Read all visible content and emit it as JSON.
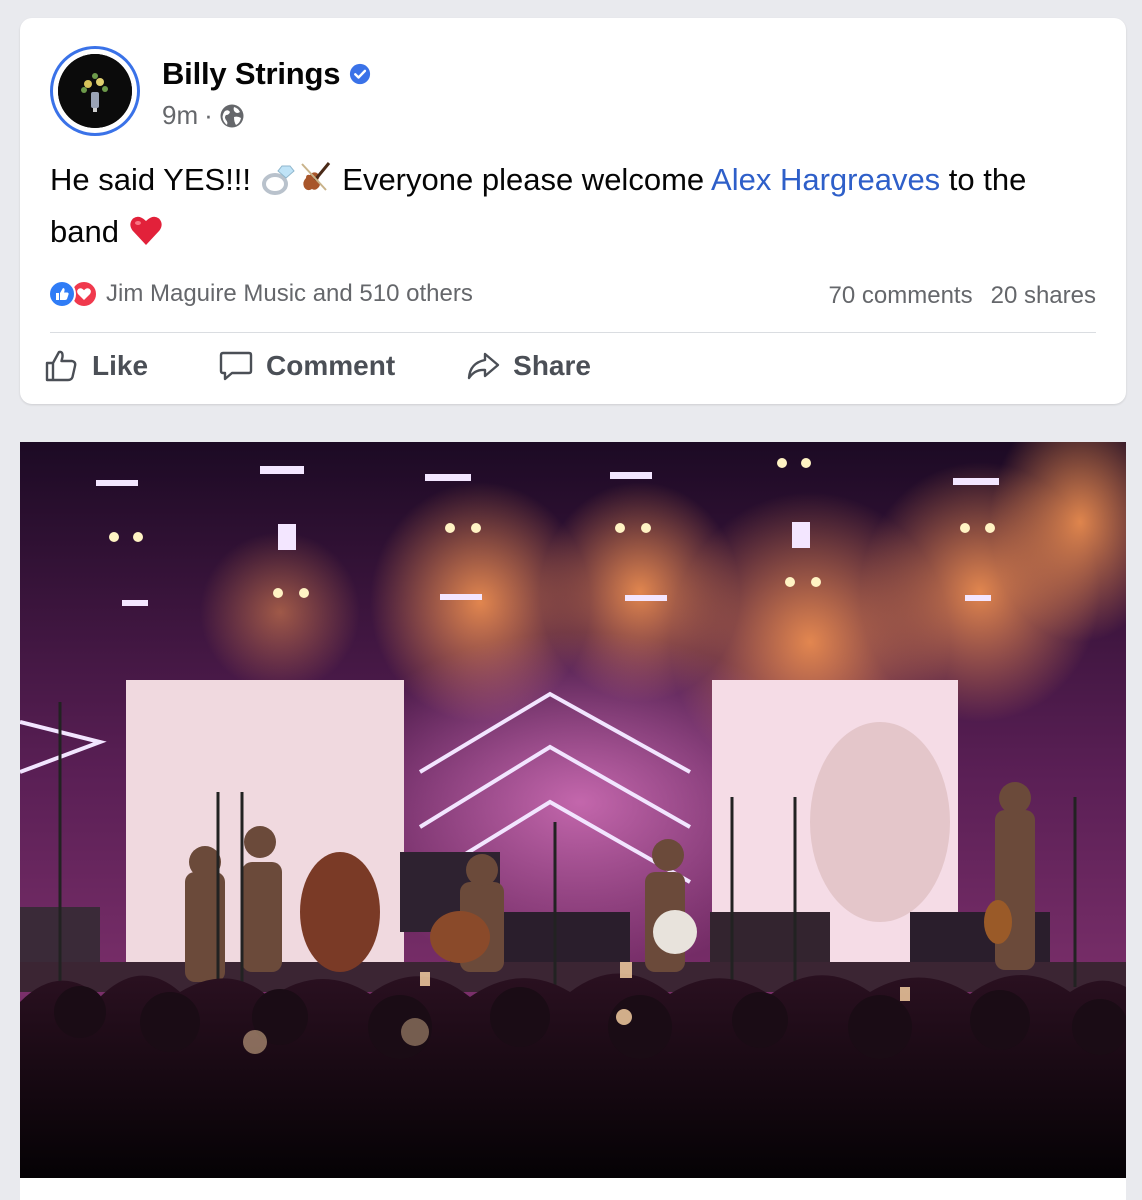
{
  "post": {
    "page_name": "Billy Strings",
    "time": "9m",
    "separator": "·",
    "text_before": "He said YES!!! ",
    "text_middle": " Everyone please welcome ",
    "mention": "Alex Hargreaves",
    "text_after": " to the band ",
    "reactions_label": "Jim Maguire Music and 510 others",
    "comments_count": "70 comments",
    "shares_count": "20 shares"
  },
  "actions": {
    "like": "Like",
    "comment": "Comment",
    "share": "Share"
  },
  "colors": {
    "verified_blue": "#3a72e8",
    "link_blue": "#2e5fc9",
    "like_blue": "#2f7cf6",
    "love_red": "#f0394d",
    "secondary_text": "#65676b"
  },
  "icons": {
    "verified": "verified-badge-icon",
    "audience": "globe-icon",
    "like": "thumbs-up-icon",
    "comment": "speech-bubble-icon",
    "share": "share-arrow-icon"
  }
}
